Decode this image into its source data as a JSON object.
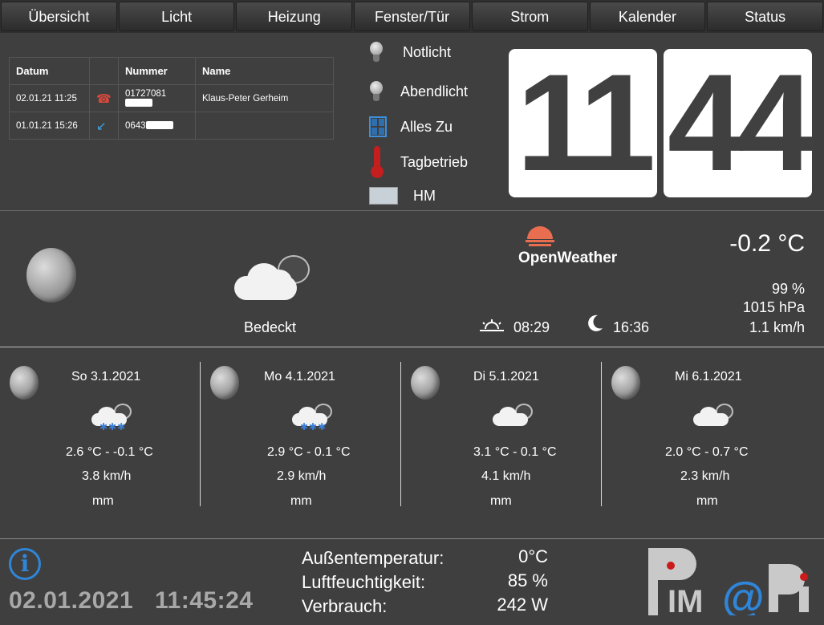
{
  "nav": {
    "tabs": [
      "Übersicht",
      "Licht",
      "Heizung",
      "Fenster/Tür",
      "Strom",
      "Kalender",
      "Status"
    ]
  },
  "calls": {
    "headers": [
      "Datum",
      "",
      "Nummer",
      "Name"
    ],
    "rows": [
      {
        "datum": "02.01.21 11:25",
        "icon": "missed-call-icon",
        "nummer": "01727081",
        "name": "Klaus-Peter Gerheim"
      },
      {
        "datum": "01.01.21 15:26",
        "icon": "incoming-call-icon",
        "nummer": "0643",
        "name": ""
      }
    ]
  },
  "status": {
    "notlicht": "Notlicht",
    "abendlicht": "Abendlicht",
    "alles_zu": "Alles Zu",
    "tagbetrieb": "Tagbetrieb",
    "hm": "HM"
  },
  "clock": {
    "hours": "11",
    "minutes": "44"
  },
  "weather": {
    "provider": "OpenWeather",
    "condition": "Bedeckt",
    "temperature": "-0.2 °C",
    "humidity": "99 %",
    "pressure": "1015 hPa",
    "wind": "1.1 km/h",
    "sunrise": "08:29",
    "sunset": "16:36"
  },
  "forecast": [
    {
      "date": "So 3.1.2021",
      "temp": "2.6 °C -   -0.1 °C",
      "wind": "3.8 km/h",
      "rain": "mm",
      "icon": "snow-cloud-icon"
    },
    {
      "date": "Mo 4.1.2021",
      "temp": "2.9 °C -    0.1 °C",
      "wind": "2.9 km/h",
      "rain": "mm",
      "icon": "snow-cloud-icon"
    },
    {
      "date": "Di 5.1.2021",
      "temp": "3.1 °C -    0.1 °C",
      "wind": "4.1 km/h",
      "rain": "mm",
      "icon": "cloud-icon"
    },
    {
      "date": "Mi 6.1.2021",
      "temp": "2.0 °C -    0.7 °C",
      "wind": "2.3 km/h",
      "rain": "mm",
      "icon": "cloud-icon"
    }
  ],
  "footer": {
    "date": "02.01.2021",
    "time": "11:45:24",
    "aussentemp_label": "Außentemperatur:",
    "aussentemp_value": "0°C",
    "luftfeuchte_label": "Luftfeuchtigkeit:",
    "luftfeuchte_value": "85 %",
    "verbrauch_label": "Verbrauch:",
    "verbrauch_value": "242 W"
  },
  "colors": {
    "background": "#3f3f3f",
    "accent_blue": "#2f86d8",
    "accent_red": "#c41e1e",
    "openweather_orange": "#e96e50"
  }
}
